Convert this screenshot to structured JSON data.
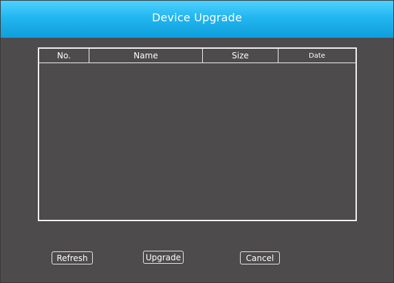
{
  "window": {
    "title": "Device Upgrade"
  },
  "file_table": {
    "columns": [
      "No.",
      "Name",
      "Size",
      "Date"
    ],
    "rows": []
  },
  "buttons": {
    "refresh": "Refresh",
    "upgrade": "Upgrade",
    "cancel": "Cancel"
  },
  "colors": {
    "titlebar": "#22b6f0",
    "background": "#4e4b4d",
    "text": "#ffffff"
  }
}
